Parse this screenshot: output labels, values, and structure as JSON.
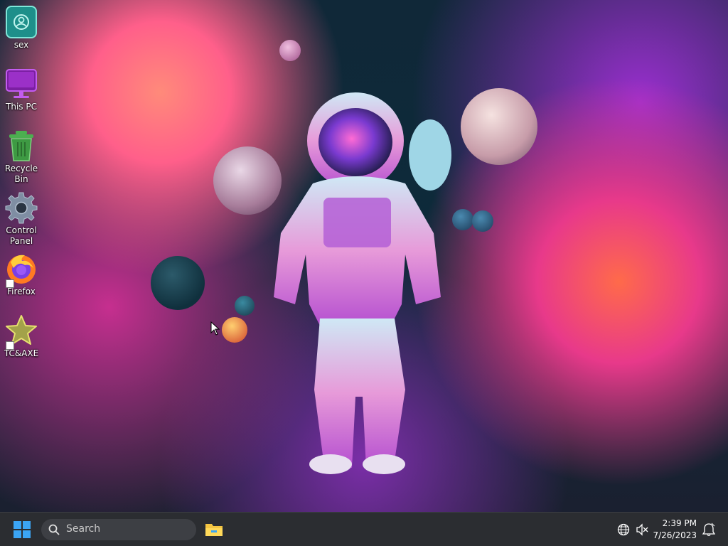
{
  "desktop": {
    "icons": [
      {
        "label": "sex",
        "icon": "user-folder-icon"
      },
      {
        "label": "This PC",
        "icon": "monitor-icon"
      },
      {
        "label": "Recycle Bin",
        "icon": "recycle-bin-icon"
      },
      {
        "label": "Control Panel",
        "icon": "gear-icon"
      },
      {
        "label": "Firefox",
        "icon": "firefox-icon"
      },
      {
        "label": "TC&AXE",
        "icon": "star-icon"
      }
    ]
  },
  "taskbar": {
    "search_placeholder": "Search",
    "pinned": [
      {
        "icon": "file-explorer-icon"
      }
    ],
    "tray": {
      "time": "2:39 PM",
      "date": "7/26/2023",
      "icons": [
        "network-globe-icon",
        "volume-muted-icon",
        "notification-bell-icon"
      ]
    }
  },
  "colors": {
    "taskbar_bg": "#2b2d31",
    "start_blue": "#3ba5f5",
    "folder_yellow": "#f4c542"
  }
}
